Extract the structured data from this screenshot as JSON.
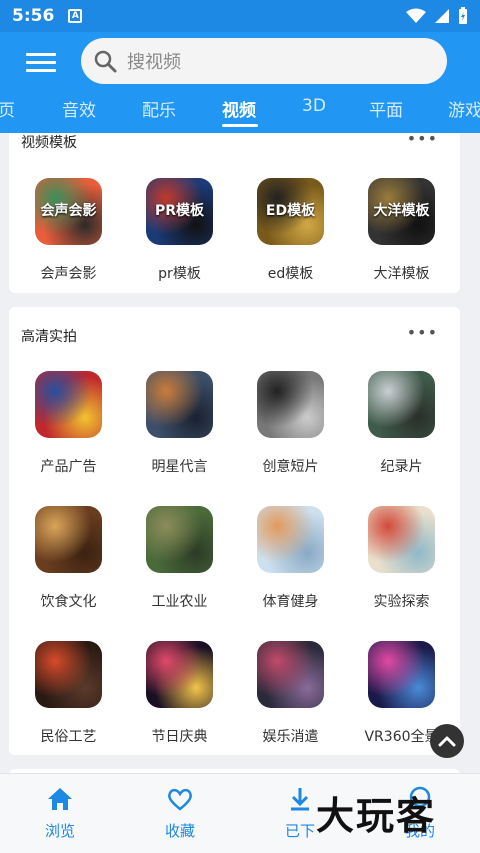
{
  "status": {
    "time": "5:56",
    "notif_glyph": "A"
  },
  "search": {
    "placeholder": "搜视频"
  },
  "tabs": [
    {
      "label": "页"
    },
    {
      "label": "音效"
    },
    {
      "label": "配乐"
    },
    {
      "label": "视频",
      "active": true
    },
    {
      "label": "3D"
    },
    {
      "label": "平面"
    },
    {
      "label": "游戏"
    }
  ],
  "video_templates": {
    "title": "视频模板",
    "more": "•••",
    "items": [
      {
        "label": "会声会影",
        "thumb_text": "会声会影",
        "colors": [
          "#e85d3a",
          "#3a8f5a",
          "#2b2b2b"
        ]
      },
      {
        "label": "pr模板",
        "thumb_text": "PR模板",
        "colors": [
          "#1b3a78",
          "#c0392b",
          "#111"
        ]
      },
      {
        "label": "ed模板",
        "thumb_text": "ED模板",
        "colors": [
          "#7a5a1a",
          "#222",
          "#d2a845"
        ]
      },
      {
        "label": "大洋模板",
        "thumb_text": "大洋模板",
        "colors": [
          "#333",
          "#9a7b3b",
          "#111"
        ]
      }
    ]
  },
  "hd_shoot": {
    "title": "高清实拍",
    "more": "•••",
    "items": [
      {
        "label": "产品广告",
        "colors": [
          "#c0282d",
          "#2a4f9e",
          "#f1c330"
        ]
      },
      {
        "label": "明星代言",
        "colors": [
          "#3d4f6a",
          "#c97b3a",
          "#1a2230"
        ]
      },
      {
        "label": "创意短片",
        "colors": [
          "#777",
          "#222",
          "#ccc"
        ]
      },
      {
        "label": "纪录片",
        "colors": [
          "#3f5b4a",
          "#c9cfd2",
          "#2a2f2a"
        ]
      },
      {
        "label": "饮食文化",
        "colors": [
          "#6a3d1f",
          "#d9a55a",
          "#3a2211"
        ]
      },
      {
        "label": "工业农业",
        "colors": [
          "#4a6a3a",
          "#8c8c5a",
          "#2c3c26"
        ]
      },
      {
        "label": "体育健身",
        "colors": [
          "#cde0ee",
          "#e29a5e",
          "#8aa9c4"
        ]
      },
      {
        "label": "实验探索",
        "colors": [
          "#e8e0cc",
          "#d24a3a",
          "#90b8c8"
        ]
      },
      {
        "label": "民俗工艺",
        "colors": [
          "#2a1a14",
          "#d84a2a",
          "#5a3a2a"
        ]
      },
      {
        "label": "节日庆典",
        "colors": [
          "#1a1024",
          "#e24a6a",
          "#f2c34a"
        ]
      },
      {
        "label": "娱乐消遣",
        "colors": [
          "#2a2a3a",
          "#c24a6a",
          "#8a6a9a"
        ]
      },
      {
        "label": "VR360全景",
        "colors": [
          "#1a1a4a",
          "#e24aa4",
          "#4a8ad8"
        ]
      }
    ]
  },
  "bottom_nav": [
    {
      "label": "浏览",
      "icon": "home-icon"
    },
    {
      "label": "收藏",
      "icon": "heart-icon"
    },
    {
      "label": "已下",
      "icon": "download-icon"
    },
    {
      "label": "我的",
      "icon": "user-icon"
    }
  ],
  "watermark": "大玩客",
  "colors": {
    "primary": "#2196f3",
    "status": "#1e88e5",
    "accent": "#1e88e5"
  }
}
